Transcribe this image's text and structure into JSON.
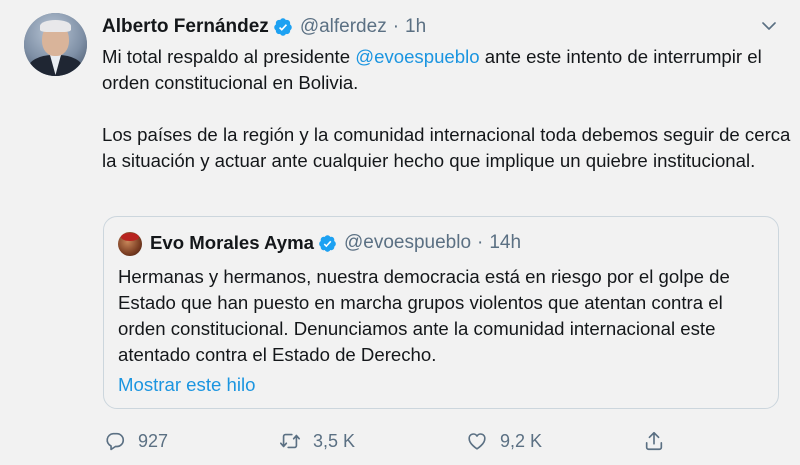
{
  "tweet": {
    "author_name": "Alberto Fernández",
    "author_handle": "@alferdez",
    "separator": "·",
    "time": "1h",
    "text_p1_before": "Mi total respaldo al presidente ",
    "text_p1_mention": "@evoespueblo",
    "text_p1_after": " ante este intento de interrumpir el orden constitucional en Bolivia.",
    "text_p2": "Los países de la región y la comunidad internacional toda debemos seguir de cerca la situación y actuar ante cualquier hecho que implique un quiebre institucional."
  },
  "quoted": {
    "author_name": "Evo Morales Ayma",
    "author_handle": "@evoespueblo",
    "separator": "·",
    "time": "14h",
    "text": "Hermanas y hermanos, nuestra democracia está en riesgo por el golpe de Estado que han puesto en marcha grupos violentos que atentan contra el orden constitucional. Denunciamos ante la comunidad internacional este atentado contra el Estado de Derecho.",
    "show_thread": "Mostrar este hilo"
  },
  "actions": {
    "replies": "927",
    "retweets": "3,5 K",
    "likes": "9,2 K"
  },
  "icons": {
    "verified": "verified-badge-icon",
    "caret": "chevron-down-icon",
    "reply": "reply-icon",
    "retweet": "retweet-icon",
    "like": "heart-icon",
    "share": "share-icon"
  },
  "colors": {
    "link": "#1b95e0",
    "secondary_text": "#5b7083",
    "verified": "#1da1f2",
    "background": "#f2f2f2"
  }
}
